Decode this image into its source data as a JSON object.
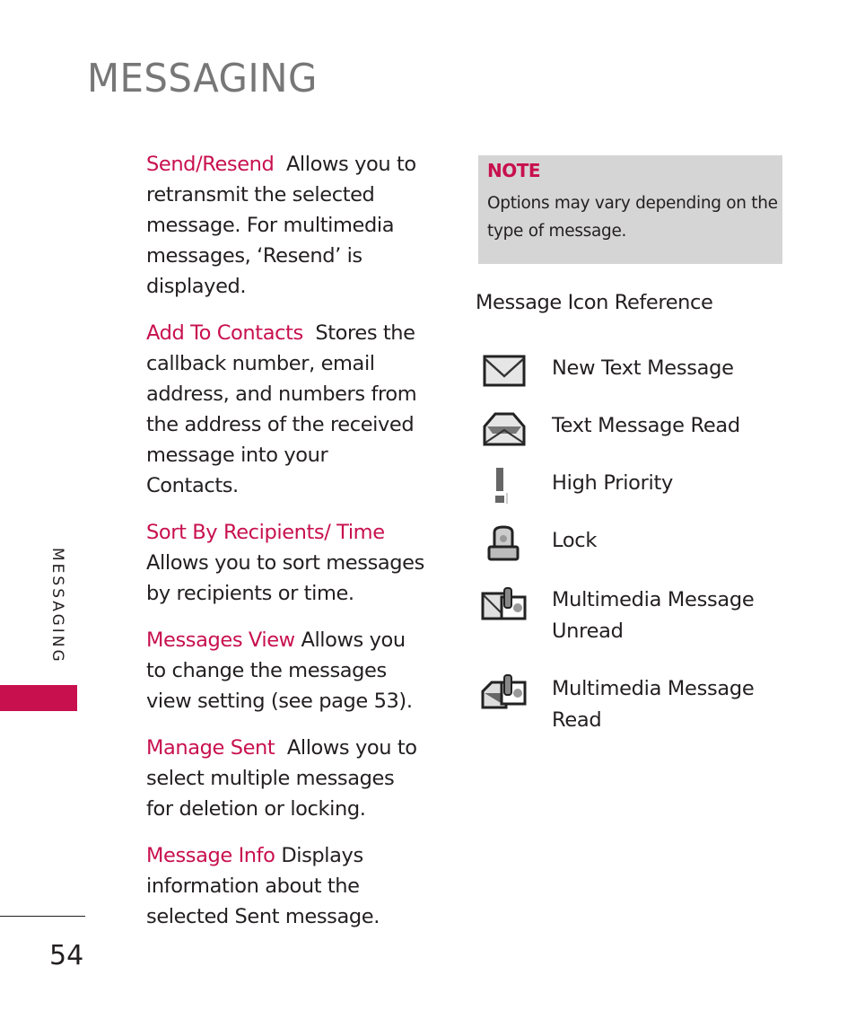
{
  "page": {
    "title": "MESSAGING",
    "side_tab_label": "MESSAGING",
    "page_number": "54",
    "accent_color": "#c8104e"
  },
  "entries": [
    {
      "term": "Send/Resend",
      "text": "Allows you to retransmit the selected message. For multimedia messages, ‘Resend’ is displayed."
    },
    {
      "term": "Add To Contacts",
      "text": "Stores the callback number, email address, and numbers from the address of the received message into your Contacts."
    },
    {
      "term": "Sort By Recipients/ Time",
      "text": "Allows you to sort messages by recipients or time."
    },
    {
      "term": "Messages View",
      "text": "Allows you to change the messages view setting (see page 53)."
    },
    {
      "term": "Manage Sent",
      "text": "Allows you to select multiple messages for deletion or locking."
    },
    {
      "term": "Message Info",
      "text": "Displays information about the selected Sent message."
    }
  ],
  "note": {
    "label": "NOTE",
    "text": "Options may vary depending on the type of message."
  },
  "icon_reference": {
    "heading": "Message Icon Reference",
    "items": [
      {
        "icon": "envelope-closed-icon",
        "label": "New Text Message"
      },
      {
        "icon": "envelope-open-icon",
        "label": "Text Message Read"
      },
      {
        "icon": "exclamation-icon",
        "label": "High Priority"
      },
      {
        "icon": "lock-icon",
        "label": "Lock"
      },
      {
        "icon": "multimedia-unread-icon",
        "label": "Multimedia Message Unread"
      },
      {
        "icon": "multimedia-read-icon",
        "label": "Multimedia Message Read"
      }
    ]
  }
}
